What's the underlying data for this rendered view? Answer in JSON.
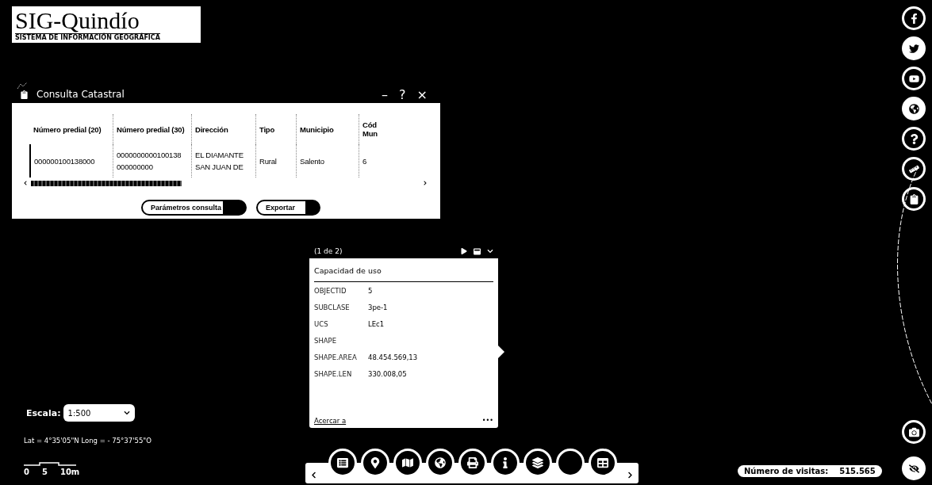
{
  "logo": {
    "title": "SIG-Quindío",
    "subtitle": "SISTEMA DE INFORMACIÓN GEOGRÁFICA"
  },
  "panel": {
    "title": "Consulta Catastral",
    "controls": [
      "–",
      "?",
      "×"
    ],
    "table": {
      "columns": [
        "Número predial (20)",
        "Número predial (30)",
        "Dirección",
        "Tipo",
        "Municipio",
        "Cód Mun"
      ],
      "rows": [
        [
          "000000100138000",
          "0000000000100138 000000000",
          "EL DIAMANTE SAN JUAN DE",
          "Rural",
          "Salento",
          "6"
        ]
      ]
    },
    "buttons": [
      "Parámetros consulta",
      "Exportar"
    ]
  },
  "popup": {
    "counter": "(1 de 2)",
    "title": "Capacidad de uso",
    "fields": [
      {
        "label": "OBJECTID",
        "value": "5"
      },
      {
        "label": "SUBCLASE",
        "value": "3pe-1"
      },
      {
        "label": "UCS",
        "value": "LEc1"
      },
      {
        "label": "SHAPE"
      },
      {
        "label": "SHAPE.AREA",
        "value": "48.454.569,13"
      },
      {
        "label": "SHAPE.LEN",
        "value": "330.008,05"
      }
    ],
    "link": "Acercar a",
    "more": "•••"
  },
  "scale": {
    "label": "Escala:",
    "value": "1:500"
  },
  "coordinates": "Lat = 4°35'05\"N Long = - 75°37'55\"O",
  "scalebar": [
    "0",
    "5",
    "10m"
  ],
  "visits": {
    "label": "Número de visitas:",
    "value": "515.565"
  }
}
